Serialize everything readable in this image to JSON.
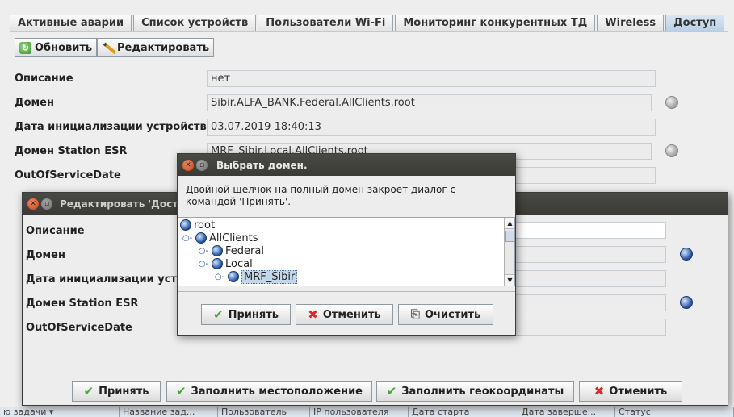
{
  "tabs": [
    "Активные аварии",
    "Список устройств",
    "Пользователи Wi-Fi",
    "Мониторинг конкурентных ТД",
    "Wireless",
    "Доступ"
  ],
  "toolbar": {
    "refresh_label": "Обновить",
    "edit_label": "Редактировать"
  },
  "main_form": {
    "description_label": "Описание",
    "description_value": "нет",
    "domain_label": "Домен",
    "domain_value": "Sibir.ALFA_BANK.Federal.AllClients.root",
    "init_date_label": "Дата инициализации устройства",
    "init_date_value": "03.07.2019 18:40:13",
    "esr_label": "Домен Station ESR",
    "esr_value": "MRF_Sibir.Local.AllClients.root",
    "oos_label": "OutOfServiceDate"
  },
  "edit_window": {
    "title": "Редактировать 'Дост",
    "description_label": "Описание",
    "domain_label": "Домен",
    "init_date_label": "Дата инициализации устро",
    "esr_label": "Домен Station ESR",
    "oos_label": "OutOfServiceDate",
    "buttons": {
      "accept": "Принять",
      "fill_location": "Заполнить местоположение",
      "fill_geo": "Заполнить геокоординаты",
      "cancel": "Отменить"
    }
  },
  "domain_dialog": {
    "title": "Выбрать домен.",
    "hint": "Двойной щелчок на полный домен закроет диалог с командой 'Принять'.",
    "tree": [
      {
        "label": "root",
        "depth": 0,
        "connector": ""
      },
      {
        "label": "AllClients",
        "depth": 1,
        "connector": "○-"
      },
      {
        "label": "Federal",
        "depth": 2,
        "connector": "○-"
      },
      {
        "label": "Local",
        "depth": 2,
        "connector": "○-"
      },
      {
        "label": "MRF_Sibir",
        "depth": 3,
        "connector": "○-",
        "selected": true
      }
    ],
    "buttons": {
      "accept": "Принять",
      "cancel": "Отменить",
      "clear": "Очистить"
    }
  },
  "bottom_table": {
    "columns": [
      "ю задачи ▾",
      "Название зад...",
      "Пользователь",
      "IP пользователя",
      "Дата старта",
      "Дата заверше...",
      "Статус"
    ]
  },
  "colors": {
    "title_bar": "#3b3a36",
    "accept_check": "#49a53c",
    "cancel_cross": "#d92b2b",
    "selection": "#c4d6ea"
  }
}
